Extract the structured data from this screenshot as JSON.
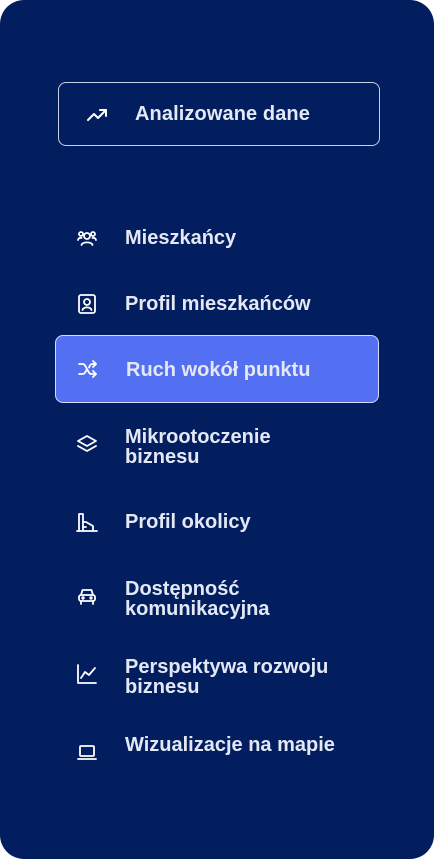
{
  "top_button": {
    "label": "Analizowane dane",
    "icon": "trending-up-icon"
  },
  "nav": {
    "items": [
      {
        "label": "Mieszkańcy",
        "icon": "users-icon",
        "active": false
      },
      {
        "label": "Profil mieszkańców",
        "icon": "user-profile-icon",
        "active": false
      },
      {
        "label": "Ruch wokół punktu",
        "icon": "shuffle-icon",
        "active": true
      },
      {
        "label": "Mikrootoczenie biznesu",
        "icon": "layers-icon",
        "active": false
      },
      {
        "label": "Profil okolicy",
        "icon": "building-icon",
        "active": false
      },
      {
        "label": "Dostępność komunikacyjna",
        "icon": "car-icon",
        "active": false
      },
      {
        "label": "Perspektywa rozwoju biznesu",
        "icon": "line-chart-icon",
        "active": false
      },
      {
        "label": "Wizualizacje na mapie",
        "icon": "laptop-icon",
        "active": false
      }
    ]
  },
  "colors": {
    "background": "#031E5F",
    "active": "#5470F2",
    "text": "#E4E8F5"
  }
}
